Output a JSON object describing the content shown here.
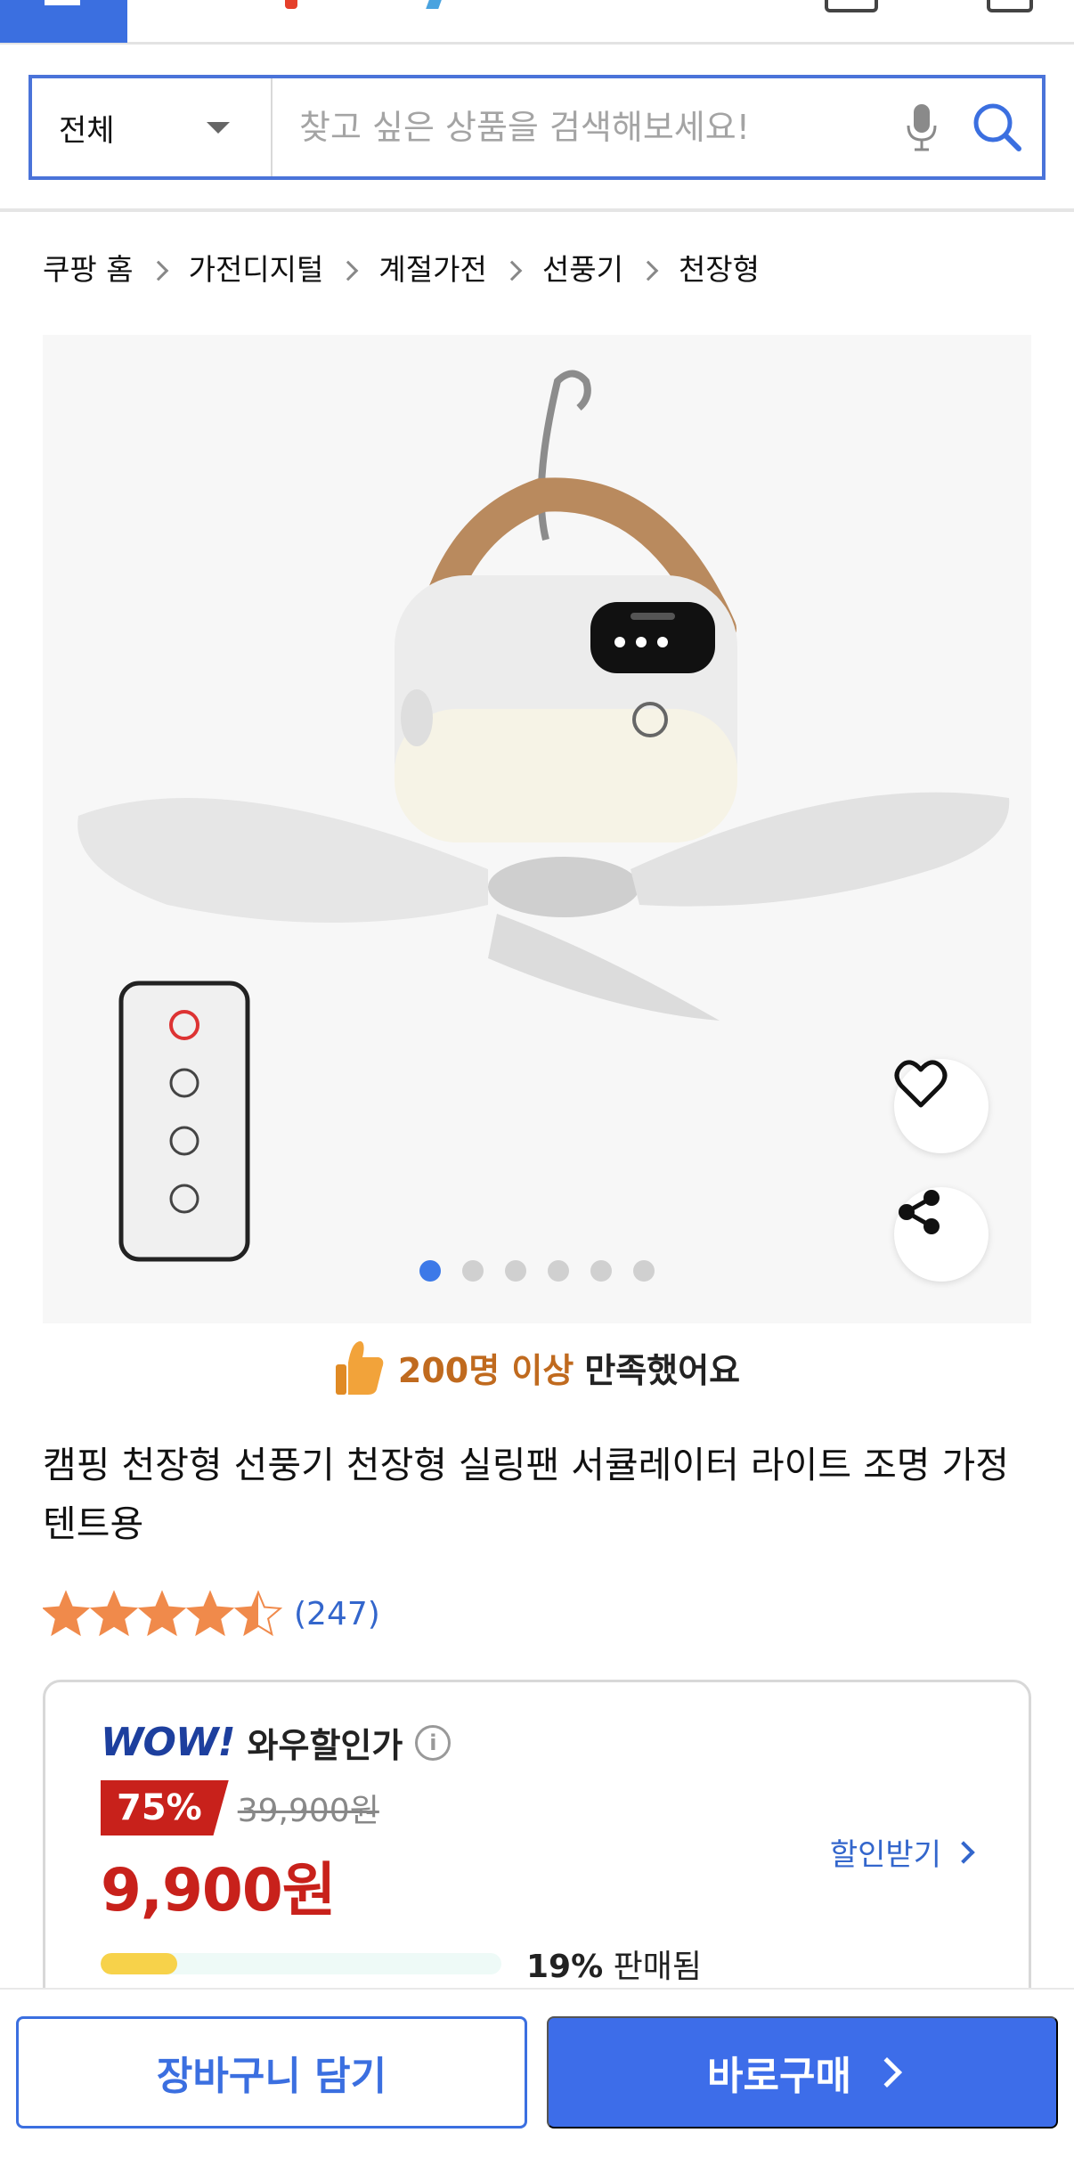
{
  "header": {
    "menu_icon": "hamburger-icon",
    "cart_icon": "cart-icon",
    "mypage_icon": "person-icon"
  },
  "search": {
    "category": "전체",
    "placeholder": "찾고 싶은 상품을 검색해보세요!",
    "mic_icon": "microphone-icon",
    "search_icon": "search-icon"
  },
  "breadcrumb": [
    "쿠팡 홈",
    "가전디지털",
    "계절가전",
    "선풍기",
    "천장형"
  ],
  "gallery": {
    "image_count": 6,
    "active_index": 0,
    "wishlist_icon": "heart-icon",
    "share_icon": "share-icon"
  },
  "satisfaction": {
    "highlight": "200명 이상",
    "text": "만족했어요",
    "icon": "thumbs-up-icon"
  },
  "product": {
    "title": "캠핑 천장형 선풍기 천장형 실링팬 서큘레이터 라이트 조명 가정 텐트용",
    "rating": 4.5,
    "review_count": "(247)"
  },
  "price": {
    "wow_brand": "WOW!",
    "wow_label": "와우할인가",
    "discount_percent": "75%",
    "original_price": "39,900원",
    "sale_price": "9,900원",
    "coupon_label": "할인받기",
    "sold_percent_text": "19%",
    "sold_label": "판매됨",
    "sold_fraction": 0.19
  },
  "actions": {
    "cart_label": "장바구니 담기",
    "buy_label": "바로구매"
  },
  "colors": {
    "accent": "#3d6de9",
    "price_red": "#c8211b",
    "star": "#f08a4b"
  }
}
